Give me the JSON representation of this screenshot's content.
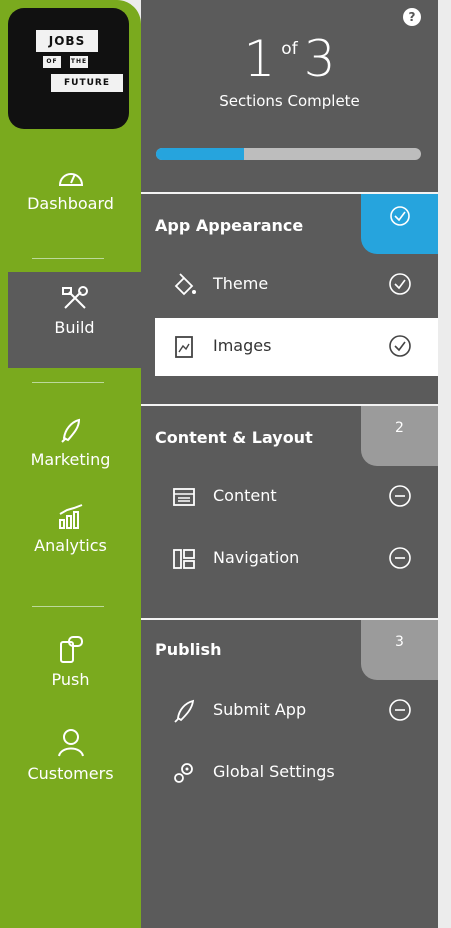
{
  "logo": {
    "line1": "JOBS",
    "line2a": "OF",
    "line2b": "THE",
    "line3": "FUTURE"
  },
  "nav": [
    {
      "label": "Dashboard",
      "icon": "speedometer-icon",
      "active": false
    },
    {
      "label": "Build",
      "icon": "tools-icon",
      "active": true
    },
    {
      "label": "Marketing",
      "icon": "rocket-icon",
      "active": false
    },
    {
      "label": "Analytics",
      "icon": "bar-chart-icon",
      "active": false
    },
    {
      "label": "Push",
      "icon": "phone-message-icon",
      "active": false
    },
    {
      "label": "Customers",
      "icon": "person-icon",
      "active": false
    }
  ],
  "help": "?",
  "progress": {
    "completed": "1",
    "of": "of",
    "total": "3",
    "label": "Sections Complete",
    "fraction": 0.333
  },
  "sections": [
    {
      "title": "App Appearance",
      "badge": "",
      "badge_icon": "check-circle-icon",
      "badge_color": "#26a4dd",
      "items": [
        {
          "label": "Theme",
          "icon": "paint-bucket-icon",
          "status": "done"
        },
        {
          "label": "Images",
          "icon": "image-icon",
          "status": "done",
          "selected": true
        }
      ]
    },
    {
      "title": "Content & Layout",
      "badge": "2",
      "badge_color": "#9b9b9b",
      "items": [
        {
          "label": "Content",
          "icon": "content-icon",
          "status": "todo"
        },
        {
          "label": "Navigation",
          "icon": "navigation-icon",
          "status": "todo"
        }
      ]
    },
    {
      "title": "Publish",
      "badge": "3",
      "badge_color": "#9b9b9b",
      "items": [
        {
          "label": "Submit App",
          "icon": "rocket-icon",
          "status": "todo"
        },
        {
          "label": "Global Settings",
          "icon": "gears-icon",
          "status": "none"
        }
      ]
    }
  ]
}
